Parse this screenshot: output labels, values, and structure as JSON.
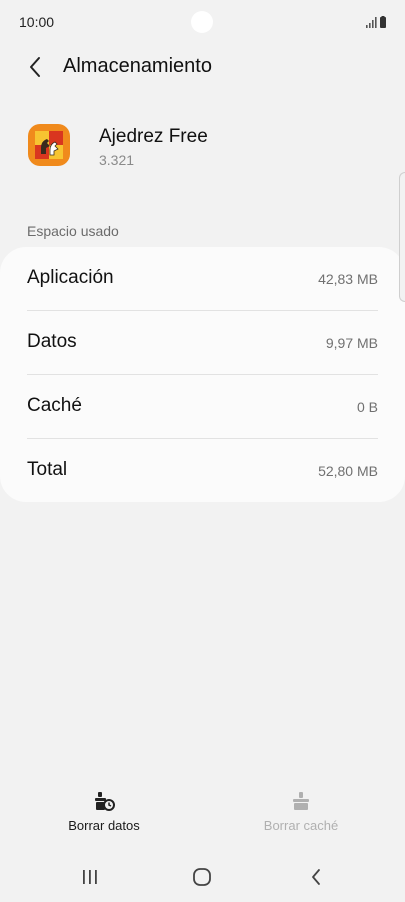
{
  "status_bar": {
    "time": "10:00"
  },
  "header": {
    "title": "Almacenamiento"
  },
  "app": {
    "name": "Ajedrez Free",
    "version": "3.321"
  },
  "section": {
    "label": "Espacio usado"
  },
  "storage": {
    "rows": [
      {
        "label": "Aplicación",
        "value": "42,83 MB"
      },
      {
        "label": "Datos",
        "value": "9,97 MB"
      },
      {
        "label": "Caché",
        "value": "0 B"
      },
      {
        "label": "Total",
        "value": "52,80 MB"
      }
    ]
  },
  "actions": {
    "clear_data": {
      "label": "Borrar datos",
      "enabled": true,
      "icon": "clear-data-icon"
    },
    "clear_cache": {
      "label": "Borrar caché",
      "enabled": false,
      "icon": "clear-cache-icon"
    }
  },
  "colors": {
    "background": "#f2f2f2",
    "card": "#fbfbfb",
    "disabled_text": "#b0b0b0",
    "app_icon_orange": "#f08a1c"
  }
}
